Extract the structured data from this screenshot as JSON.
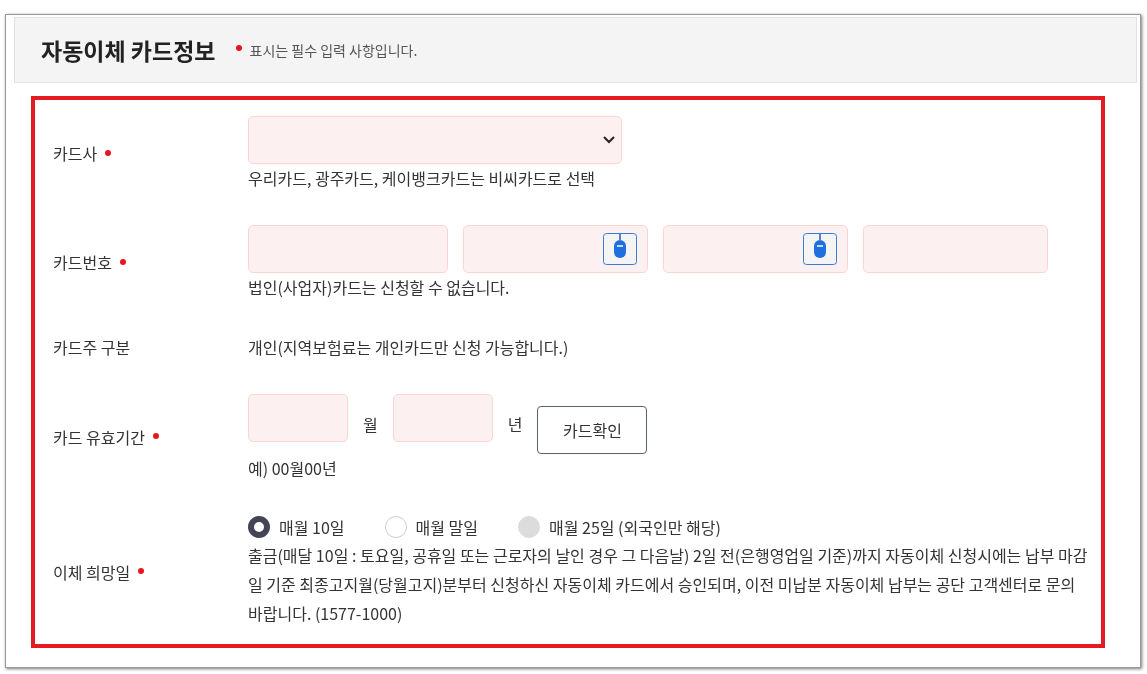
{
  "header": {
    "title": "자동이체 카드정보",
    "required_note": "표시는 필수 입력 사항입니다."
  },
  "rows": [
    {
      "kind": "select",
      "label": "카드사",
      "required": true,
      "hint": "우리카드, 광주카드, 케이뱅크카드는 비씨카드로 선택"
    },
    {
      "kind": "card_number",
      "label": "카드번호",
      "required": true,
      "fields": [
        {
          "keypad": false
        },
        {
          "keypad": true
        },
        {
          "keypad": true
        },
        {
          "keypad": false
        }
      ],
      "hint": "법인(사업자)카드는 신청할 수 없습니다."
    },
    {
      "kind": "text",
      "label": "카드주 구분",
      "required": false,
      "value": "개인(지역보험료는 개인카드만 신청 가능합니다.)"
    },
    {
      "kind": "expiry",
      "label": "카드 유효기간",
      "required": true,
      "month_unit": "월",
      "year_unit": "년",
      "button": "카드확인",
      "hint": "예) 00월00년"
    },
    {
      "kind": "radio",
      "label": "이체 희망일",
      "required": true,
      "options": [
        {
          "label": "매월 10일",
          "selected": true,
          "disabled": false
        },
        {
          "label": "매월 말일",
          "selected": false,
          "disabled": false
        },
        {
          "label": "매월 25일 (외국인만 해당)",
          "selected": false,
          "disabled": true
        }
      ],
      "hint": "출금(매달 10일 : 토요일, 공휴일 또는 근로자의 날인 경우 그 다음날) 2일 전(은행영업일 기준)까지 자동이체 신청시에는 납부 마감일 기준 최종고지월(당월고지)분부터 신청하신 자동이체 카드에서 승인되며, 이전 미납분 자동이체 납부는 공단 고객센터로 문의 바랍니다. (1577-1000)"
    }
  ]
}
